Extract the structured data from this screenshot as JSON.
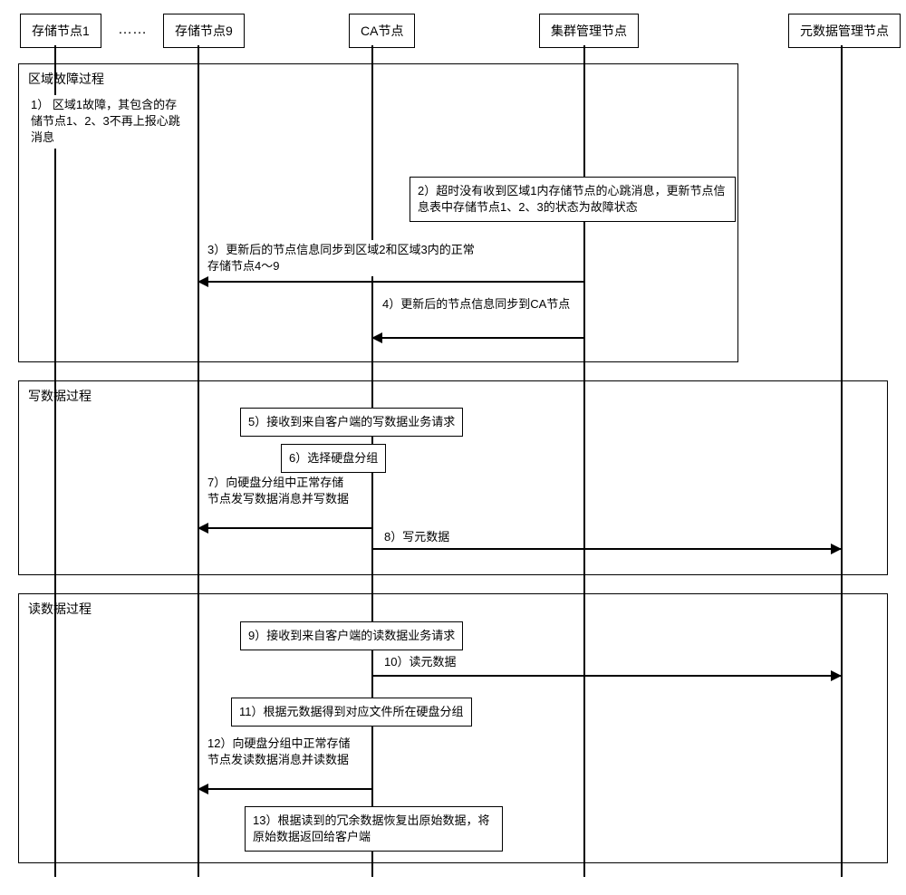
{
  "participants": {
    "storage1": "存储节点1",
    "storage9": "存储节点9",
    "ca": "CA节点",
    "cluster": "集群管理节点",
    "metadata": "元数据管理节点"
  },
  "ellipsis": "……",
  "groups": {
    "fault": {
      "title": "区域故障过程",
      "step1": "1） 区域1故障，其包含的存储节点1、2、3不再上报心跳消息",
      "step2": "2）超时没有收到区域1内存储节点的心跳消息，更新节点信息表中存储节点1、2、3的状态为故障状态",
      "step3": "3）更新后的节点信息同步到区域2和区域3内的正常存储节点4～9",
      "step4": "4）更新后的节点信息同步到CA节点"
    },
    "write": {
      "title": "写数据过程",
      "step5": "5）接收到来自客户端的写数据业务请求",
      "step6": "6）选择硬盘分组",
      "step7": "7）向硬盘分组中正常存储节点发写数据消息并写数据",
      "step8": "8）写元数据"
    },
    "read": {
      "title": "读数据过程",
      "step9": "9）接收到来自客户端的读数据业务请求",
      "step10": "10）读元数据",
      "step11": "11）根据元数据得到对应文件所在硬盘分组",
      "step12": "12）向硬盘分组中正常存储节点发读数据消息并读数据",
      "step13": "13）根据读到的冗余数据恢复出原始数据，将原始数据返回给客户端"
    }
  }
}
